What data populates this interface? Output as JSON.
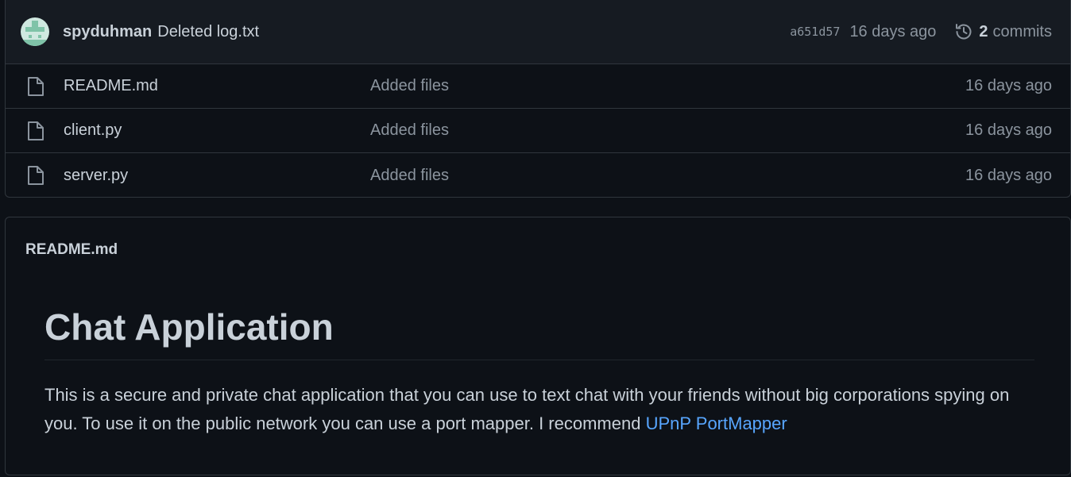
{
  "commit": {
    "author": "spyduhman",
    "message": "Deleted log.txt",
    "sha": "a651d57",
    "age": "16 days ago",
    "commit_count": "2",
    "commit_label": "commits"
  },
  "files": [
    {
      "name": "README.md",
      "message": "Added files",
      "age": "16 days ago",
      "icon": "file-icon"
    },
    {
      "name": "client.py",
      "message": "Added files",
      "age": "16 days ago",
      "icon": "file-icon"
    },
    {
      "name": "server.py",
      "message": "Added files",
      "age": "16 days ago",
      "icon": "file-icon"
    }
  ],
  "readme": {
    "filename": "README.md",
    "heading": "Chat Application",
    "body_text": "This is a secure and private chat application that you can use to text chat with your friends without big corporations spying on you. To use it on the public network you can use a port mapper. I recommend ",
    "link_text": "UPnP PortMapper"
  },
  "colors": {
    "background": "#0d1117",
    "header_bg": "#161b22",
    "border": "#30363d",
    "text": "#c9d1d9",
    "muted": "#8b949e",
    "link": "#58a6ff"
  }
}
